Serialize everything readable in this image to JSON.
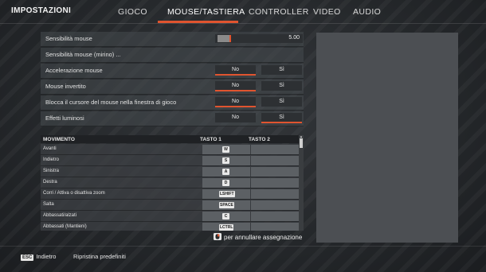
{
  "header": {
    "title": "IMPOSTAZIONI",
    "tabs": [
      {
        "label": "GIOCO"
      },
      {
        "label": "MOUSE/TASTIERA"
      },
      {
        "label": "CONTROLLER"
      },
      {
        "label": "VIDEO"
      },
      {
        "label": "AUDIO"
      }
    ],
    "active_tab": "MOUSE/TASTIERA"
  },
  "settings": {
    "sensitivity": {
      "label": "Sensibilità mouse",
      "value": "5.00"
    },
    "sensitivity_aim": {
      "label": "Sensibilità mouse (mirino) ..."
    },
    "acceleration": {
      "label": "Accelerazione mouse",
      "no": "No",
      "yes": "Sì",
      "selected": "No"
    },
    "invert": {
      "label": "Mouse invertito",
      "no": "No",
      "yes": "Sì",
      "selected": "No"
    },
    "lock_cursor": {
      "label": "Blocca il cursore del mouse nella finestra di gioco",
      "no": "No",
      "yes": "Sì",
      "selected": "No"
    },
    "light_effects": {
      "label": "Effetti luminosi",
      "no": "No",
      "yes": "Sì",
      "selected": "Sì"
    }
  },
  "bindings": {
    "headers": {
      "action": "MOVIMENTO",
      "key1": "TASTO 1",
      "key2": "TASTO 2"
    },
    "rows": [
      {
        "action": "Avanti",
        "key1": "W",
        "key2": ""
      },
      {
        "action": "Indietro",
        "key1": "S",
        "key2": ""
      },
      {
        "action": "Sinistra",
        "key1": "A",
        "key2": ""
      },
      {
        "action": "Destra",
        "key1": "D",
        "key2": ""
      },
      {
        "action": "Corri / Attiva o disattiva zoom",
        "key1": "LSHIFT",
        "key2": ""
      },
      {
        "action": "Salta",
        "key1": "SPACE",
        "key2": ""
      },
      {
        "action": "Abbassati/alzati",
        "key1": "C",
        "key2": ""
      },
      {
        "action": "Abbassati (Mantieni)",
        "key1": "LCTRL",
        "key2": ""
      }
    ]
  },
  "hint": {
    "text": "per annullare assegnazione",
    "icon": "mouse-right-click-icon"
  },
  "footer": {
    "back_key": "ESC",
    "back_label": "Indietro",
    "reset_label": "Ripristina predefiniti"
  },
  "colors": {
    "accent": "#e0542f"
  }
}
